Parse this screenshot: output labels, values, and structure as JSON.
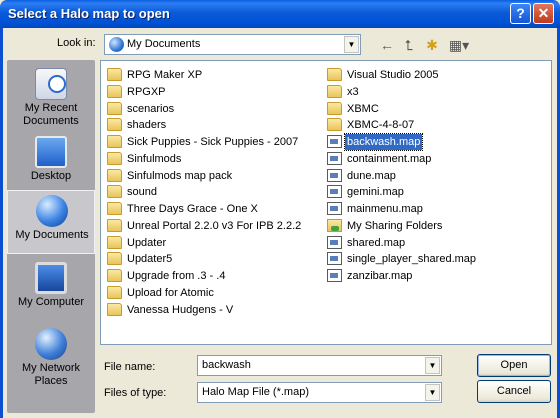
{
  "window": {
    "title": "Select a Halo map to open",
    "help_label": "?",
    "close_label": "✕"
  },
  "lookin": {
    "label": "Look in:",
    "value": "My Documents",
    "icon": "my-documents-globe-icon"
  },
  "toolbar": {
    "back_icon": "back-arrow-icon",
    "up_icon": "up-one-level-icon",
    "new_folder_icon": "new-folder-icon",
    "views_icon": "views-menu-icon",
    "back_glyph": "←",
    "up_glyph": "⮤",
    "new_glyph": "✱",
    "views_glyph": "▦▾"
  },
  "places": [
    {
      "label": "My Recent Documents",
      "icon": "recent-documents-icon",
      "selected": false
    },
    {
      "label": "Desktop",
      "icon": "desktop-icon",
      "selected": false
    },
    {
      "label": "My Documents",
      "icon": "my-documents-icon",
      "selected": true
    },
    {
      "label": "My Computer",
      "icon": "my-computer-icon",
      "selected": false
    },
    {
      "label": "My Network Places",
      "icon": "network-places-icon",
      "selected": false
    }
  ],
  "files_col1": [
    {
      "name": "RPG Maker XP",
      "type": "folder"
    },
    {
      "name": "RPGXP",
      "type": "folder"
    },
    {
      "name": "scenarios",
      "type": "folder"
    },
    {
      "name": "shaders",
      "type": "folder"
    },
    {
      "name": "Sick Puppies - Sick Puppies - 2007",
      "type": "folder"
    },
    {
      "name": "Sinfulmods",
      "type": "folder"
    },
    {
      "name": "Sinfulmods map pack",
      "type": "folder"
    },
    {
      "name": "sound",
      "type": "folder"
    },
    {
      "name": "Three Days Grace - One X",
      "type": "folder"
    },
    {
      "name": "Unreal Portal 2.2.0 v3 For IPB 2.2.2",
      "type": "folder"
    },
    {
      "name": "Updater",
      "type": "folder"
    },
    {
      "name": "Updater5",
      "type": "folder"
    },
    {
      "name": "Upgrade from .3 - .4",
      "type": "folder"
    },
    {
      "name": "Upload for Atomic",
      "type": "folder"
    },
    {
      "name": "Vanessa Hudgens - V",
      "type": "folder"
    }
  ],
  "files_col2": [
    {
      "name": "Visual Studio 2005",
      "type": "folder"
    },
    {
      "name": "x3",
      "type": "folder"
    },
    {
      "name": "XBMC",
      "type": "folder"
    },
    {
      "name": "XBMC-4-8-07",
      "type": "folder"
    },
    {
      "name": "backwash.map",
      "type": "file",
      "selected": true
    },
    {
      "name": "containment.map",
      "type": "file"
    },
    {
      "name": "dune.map",
      "type": "file"
    },
    {
      "name": "gemini.map",
      "type": "file"
    },
    {
      "name": "mainmenu.map",
      "type": "file"
    },
    {
      "name": "My Sharing Folders",
      "type": "shared"
    },
    {
      "name": "shared.map",
      "type": "file"
    },
    {
      "name": "single_player_shared.map",
      "type": "file"
    },
    {
      "name": "zanzibar.map",
      "type": "file"
    }
  ],
  "filename": {
    "label": "File name:",
    "value": "backwash"
  },
  "filetype": {
    "label": "Files of type:",
    "value": "Halo Map File (*.map)"
  },
  "buttons": {
    "open_label": "Open",
    "cancel_label": "Cancel"
  },
  "colors": {
    "titlebar": "#0054e3",
    "selection": "#316ac5",
    "dialog_bg": "#ece9d8"
  }
}
